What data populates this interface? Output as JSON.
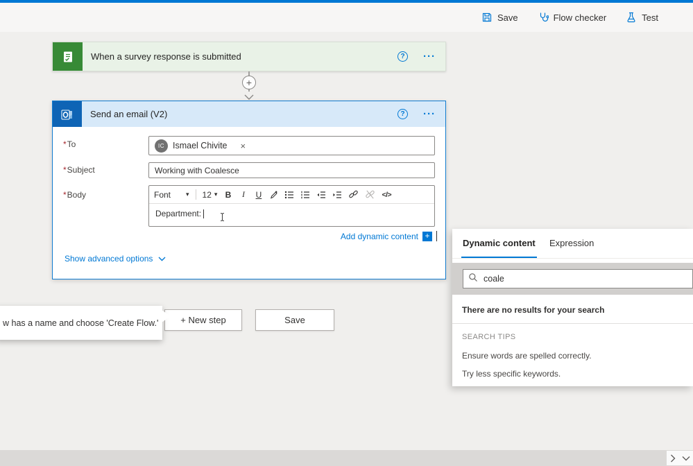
{
  "icons": {
    "required": "*",
    "caret_down": "▾",
    "ellipsis": "···",
    "help": "?",
    "close": "×",
    "plus": "+"
  },
  "colors": {
    "accent": "#0078d4",
    "trigger_green": "#378a36",
    "outlook_blue": "#0e64b5",
    "required_red": "#a4262c",
    "action_header_blue": "#d7e9f9",
    "trigger_bg_green": "#e9f2e7"
  },
  "header": {
    "save": "Save",
    "flow_checker": "Flow checker",
    "test": "Test"
  },
  "trigger": {
    "title": "When a survey response is submitted"
  },
  "action": {
    "title": "Send an email (V2)",
    "to_label": "To",
    "subject_label": "Subject",
    "body_label": "Body",
    "to_chip": {
      "initials": "IC",
      "name": "Ismael Chivite"
    },
    "subject_value": "Working with Coalesce",
    "body_value": "Department:",
    "toolbar": {
      "font": "Font",
      "size": "12",
      "bold": "B",
      "italic": "I",
      "underline": "U",
      "code": "</>"
    },
    "add_dynamic": "Add dynamic content",
    "advanced": "Show advanced options"
  },
  "actions_bar": {
    "new_step": "+ New step",
    "save": "Save"
  },
  "tooltip": {
    "text": "w has a name and choose 'Create Flow.'"
  },
  "panel": {
    "tabs": [
      {
        "label": "Dynamic content"
      },
      {
        "label": "Expression"
      }
    ],
    "search_value": "coale",
    "no_results": "There are no results for your search",
    "tips_title": "SEARCH TIPS",
    "tips": [
      "Ensure words are spelled correctly.",
      "Try less specific keywords."
    ]
  }
}
